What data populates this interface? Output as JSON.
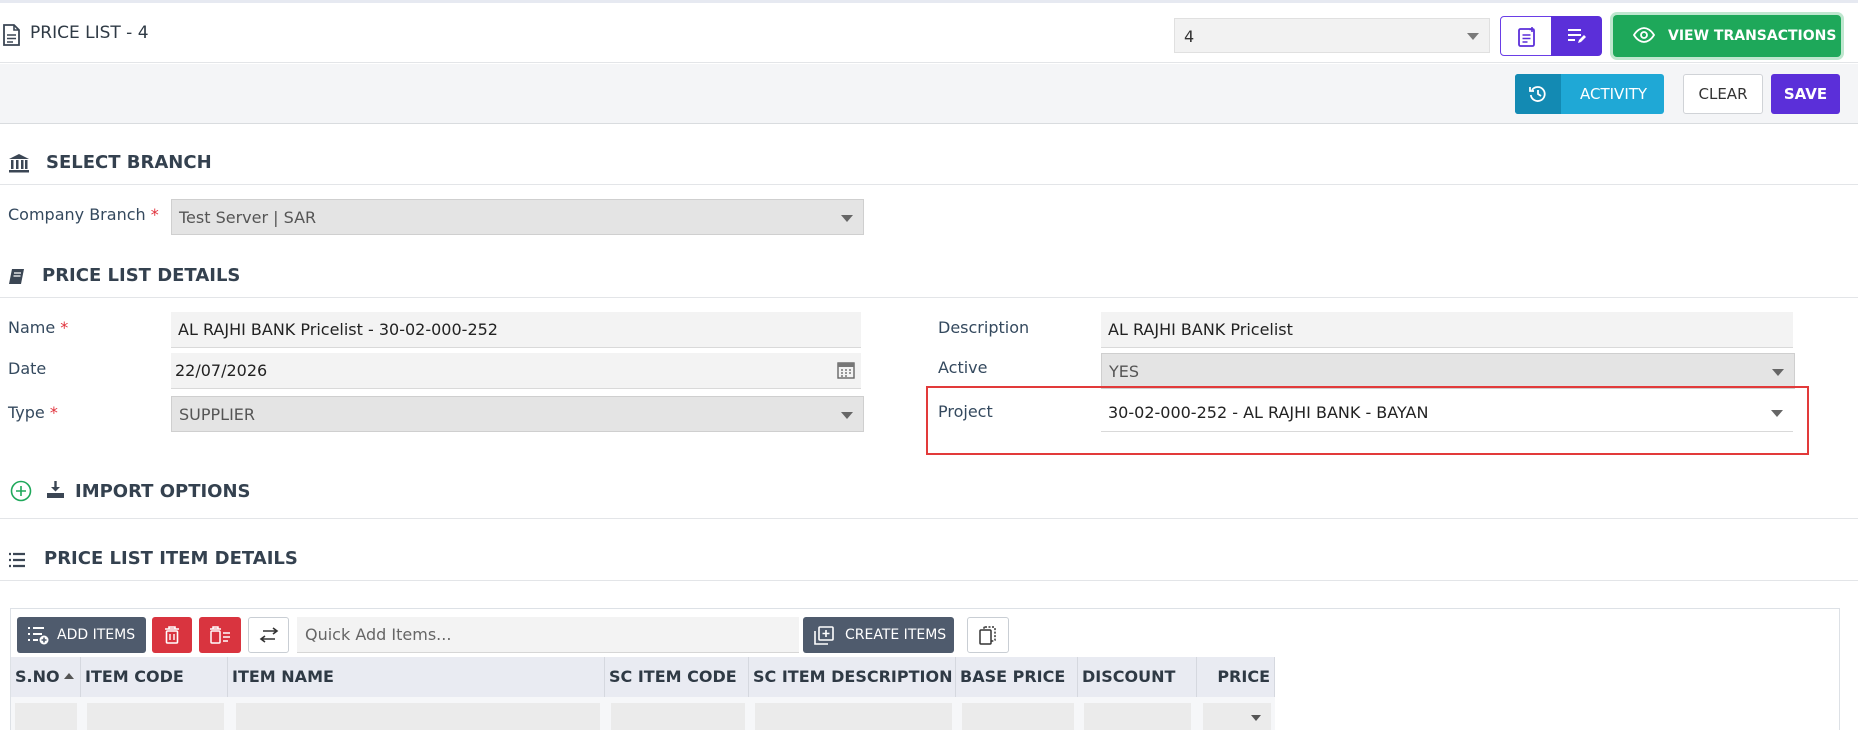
{
  "header": {
    "title": "PRICE LIST - 4",
    "record_value": "4",
    "view_transactions_label": "VIEW TRANSACTIONS"
  },
  "toolbar": {
    "activity_label": "ACTIVITY",
    "clear_label": "CLEAR",
    "save_label": "SAVE"
  },
  "select_branch": {
    "title": "SELECT BRANCH",
    "company_branch_label": "Company Branch",
    "company_branch_value": "Test Server | SAR"
  },
  "details": {
    "title": "PRICE LIST DETAILS",
    "name_label": "Name",
    "name_value": "AL RAJHI BANK Pricelist - 30-02-000-252",
    "date_label": "Date",
    "date_value": "22/07/2026",
    "type_label": "Type",
    "type_value": "SUPPLIER",
    "description_label": "Description",
    "description_value": "AL RAJHI BANK Pricelist",
    "active_label": "Active",
    "active_value": "YES",
    "project_label": "Project",
    "project_value": "30-02-000-252 - AL RAJHI BANK - BAYAN"
  },
  "import": {
    "title": "IMPORT OPTIONS"
  },
  "items": {
    "title": "PRICE LIST ITEM DETAILS",
    "add_items_label": "ADD ITEMS",
    "quick_add_placeholder": "Quick Add Items...",
    "create_items_label": "CREATE ITEMS",
    "columns": [
      "S.NO",
      "ITEM CODE",
      "ITEM NAME",
      "SC ITEM CODE",
      "SC ITEM DESCRIPTION",
      "BASE PRICE",
      "DISCOUNT",
      "PRICE"
    ]
  },
  "colors": {
    "purple": "#5b2fd9",
    "green": "#1ea85a",
    "cyan": "#1fa8d6",
    "red": "#d9343f",
    "highlight": "#e23a3a"
  }
}
